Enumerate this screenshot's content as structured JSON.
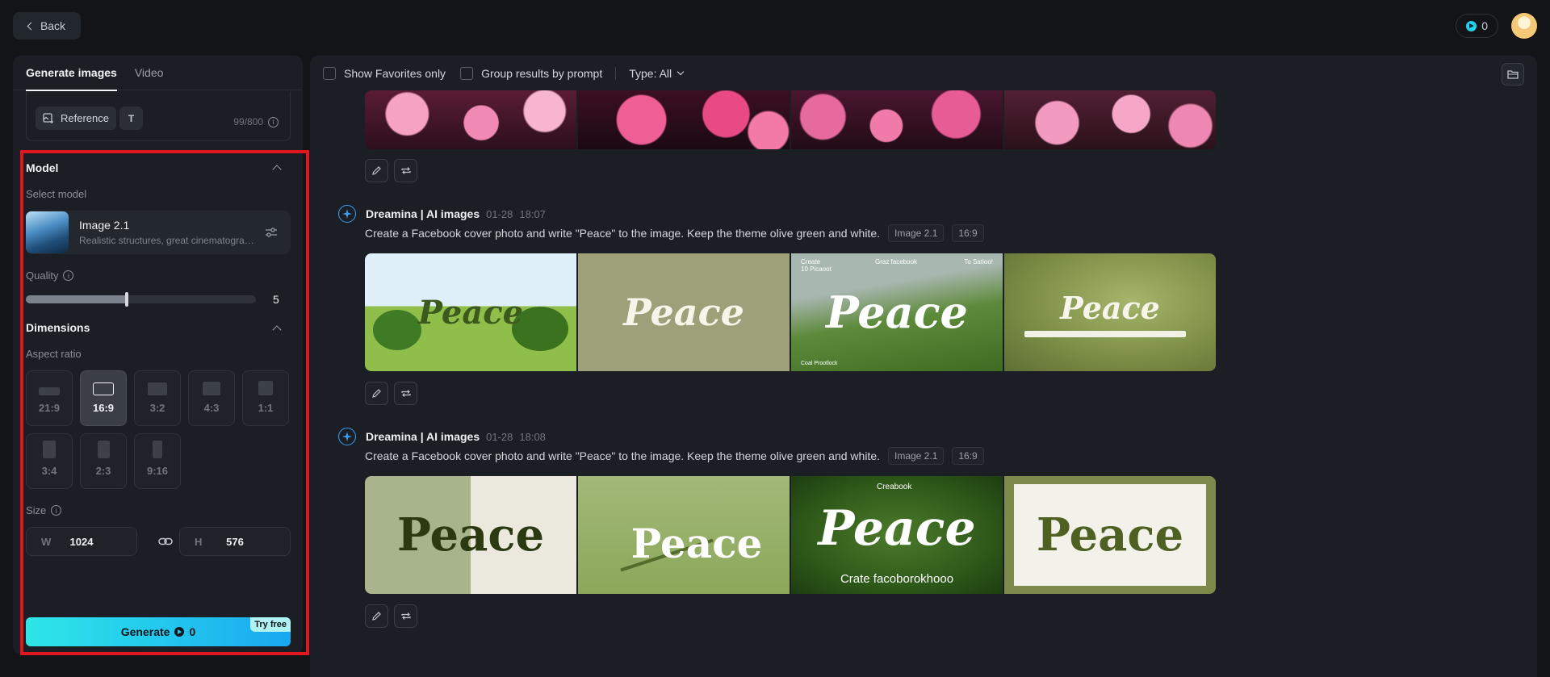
{
  "topbar": {
    "back_label": "Back",
    "credits": "0"
  },
  "left": {
    "tabs": [
      "Generate images",
      "Video"
    ],
    "reference_label": "Reference",
    "text_tool_label": "T",
    "char_count": "99/800",
    "model_section": "Model",
    "select_model_label": "Select model",
    "model_name": "Image 2.1",
    "model_desc": "Realistic structures, great cinematography...",
    "quality_label": "Quality",
    "quality_value": "5",
    "quality_fraction": 0.44,
    "dimensions_section": "Dimensions",
    "aspect_label": "Aspect ratio",
    "ratios": [
      "21:9",
      "16:9",
      "3:2",
      "4:3",
      "1:1",
      "3:4",
      "2:3",
      "9:16"
    ],
    "selected_ratio": "16:9",
    "size_label": "Size",
    "width_prefix": "W",
    "width": "1024",
    "height_prefix": "H",
    "height": "576",
    "generate_label": "Generate",
    "generate_cost": "0",
    "try_free": "Try free"
  },
  "right": {
    "show_favorites": "Show Favorites only",
    "group_results": "Group results by prompt",
    "type_filter": "Type: All",
    "groups": [
      {
        "author": "Dreamina | AI images",
        "date": "01-28",
        "time": "18:07",
        "prompt": "Create a Facebook cover photo and write \"Peace\" to the image. Keep the theme olive green and white.",
        "model_tag": "Image 2.1",
        "ratio_tag": "16:9",
        "images": [
          {
            "text": "Peace"
          },
          {
            "text": "Peace"
          },
          {
            "text": "Peace",
            "small_top_left": "Create\n10 Picaoot",
            "small_top_mid": "Graz facebook",
            "small_top_right": "To Satioo!",
            "small_bottom": "Coal Prootlock"
          },
          {
            "text": "Peace"
          }
        ]
      },
      {
        "author": "Dreamina | AI images",
        "date": "01-28",
        "time": "18:08",
        "prompt": "Create a Facebook cover photo and write \"Peace\" to the image. Keep the theme olive green and white.",
        "model_tag": "Image 2.1",
        "ratio_tag": "16:9",
        "images": [
          {
            "text": "Peace"
          },
          {
            "text": "Peace"
          },
          {
            "text": "Peace",
            "small_top_mid": "Creabook",
            "small_bottom": "Crate facoborokhooo"
          },
          {
            "text": "Peace"
          }
        ]
      }
    ]
  },
  "colors": {
    "accent": "#22d3ee",
    "highlight": "#e0171f",
    "ai_blue": "#3b9ff5"
  }
}
